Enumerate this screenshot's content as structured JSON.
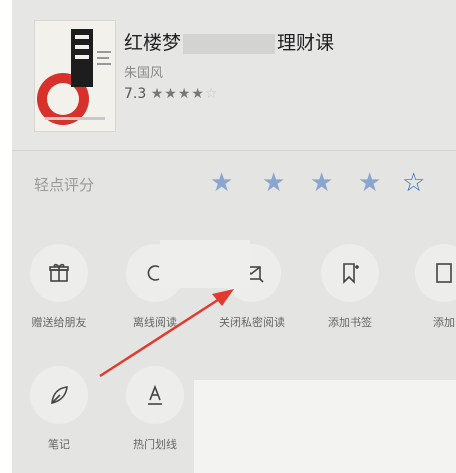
{
  "book": {
    "title": "红楼梦",
    "title_suffix": "理财课",
    "author": "朱国风",
    "rating": "7.3",
    "stars_filled": "★★★★",
    "stars_empty": "☆"
  },
  "rate": {
    "label": "轻点评分",
    "stars": [
      "★",
      "★",
      "★",
      "★",
      "☆"
    ]
  },
  "actions_row1": [
    {
      "label": "赠送给朋友",
      "icon": "gift-icon"
    },
    {
      "label": "离线阅读",
      "icon": "download-icon"
    },
    {
      "label": "关闭私密阅读",
      "icon": "private-reading-icon"
    },
    {
      "label": "添加书签",
      "icon": "bookmark-add-icon"
    },
    {
      "label": "添加",
      "icon": "add-icon"
    }
  ],
  "actions_row2": [
    {
      "label": "笔记",
      "icon": "leaf-pen-icon"
    },
    {
      "label": "热门划线",
      "icon": "underline-icon"
    }
  ],
  "colors": {
    "accent": "#3b6fb6",
    "arrow": "#e23a2e"
  }
}
